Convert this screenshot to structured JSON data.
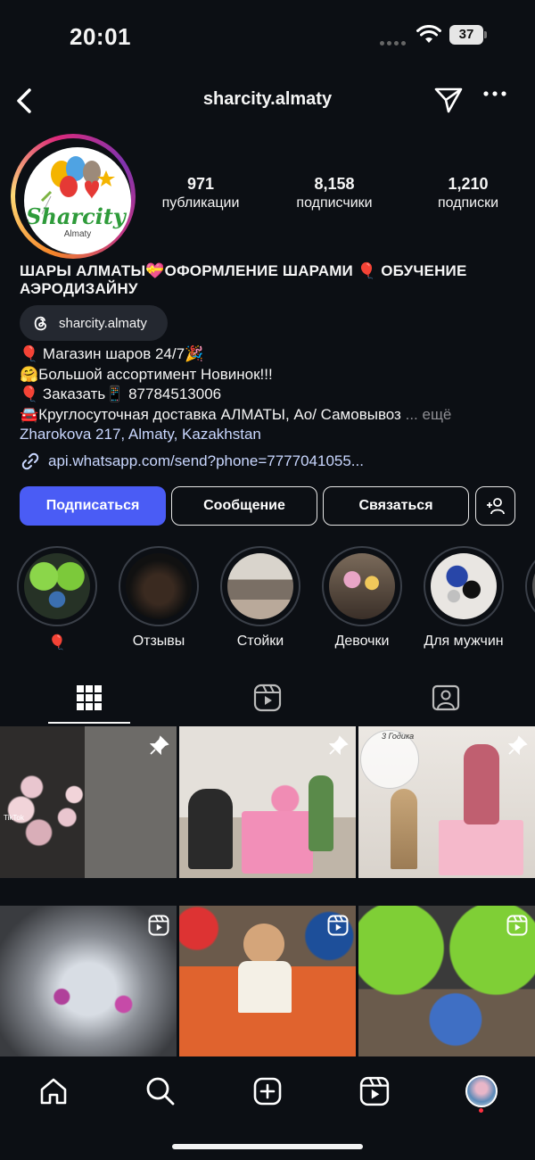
{
  "status_bar": {
    "time": "20:01",
    "battery": "37"
  },
  "header": {
    "username": "sharcity.almaty"
  },
  "avatar": {
    "brand_text": "Sharcity",
    "brand_sub": "Almaty"
  },
  "stats": [
    {
      "value": "971",
      "label": "публикации"
    },
    {
      "value": "8,158",
      "label": "подписчики"
    },
    {
      "value": "1,210",
      "label": "подписки"
    }
  ],
  "bio": {
    "name": "ШАРЫ АЛМАТЫ💝ОФОРМЛЕНИЕ ШАРАМИ 🎈 ОБУЧЕНИЕ АЭРОДИЗАЙНУ",
    "threads_handle": "sharcity.almaty",
    "lines": [
      "🎈 Магазин шаров 24/7🎉",
      "🤗Большой ассортимент Новинок!!!",
      "🎈 Заказать📱 87784513006",
      "🚘Круглосуточная доставка АЛМАТЫ, Ао/ Самовывоз"
    ],
    "more": "... ещё",
    "location": "Zharokova 217, Almaty, Kazakhstan",
    "link": "api.whatsapp.com/send?phone=7777041055..."
  },
  "buttons": {
    "follow": "Подписаться",
    "message": "Сообщение",
    "contact": "Связаться"
  },
  "highlights": [
    {
      "label": "🎈"
    },
    {
      "label": "Отзывы"
    },
    {
      "label": "Стойки"
    },
    {
      "label": "Девочки"
    },
    {
      "label": "Для мужчин"
    }
  ],
  "posts": [
    {
      "overlay": "TikTok",
      "badge": "pin-icon"
    },
    {
      "overlay": "",
      "badge": "pin-icon"
    },
    {
      "overlay": "3 Годика",
      "badge": "pin-icon"
    },
    {
      "overlay": "",
      "badge": "reel-icon"
    },
    {
      "overlay": "",
      "badge": "reel-icon"
    },
    {
      "overlay": "",
      "badge": "reel-icon"
    }
  ],
  "colors": {
    "background": "#0c0f14",
    "accent": "#4a5cf5",
    "link": "#c9d7ff"
  }
}
